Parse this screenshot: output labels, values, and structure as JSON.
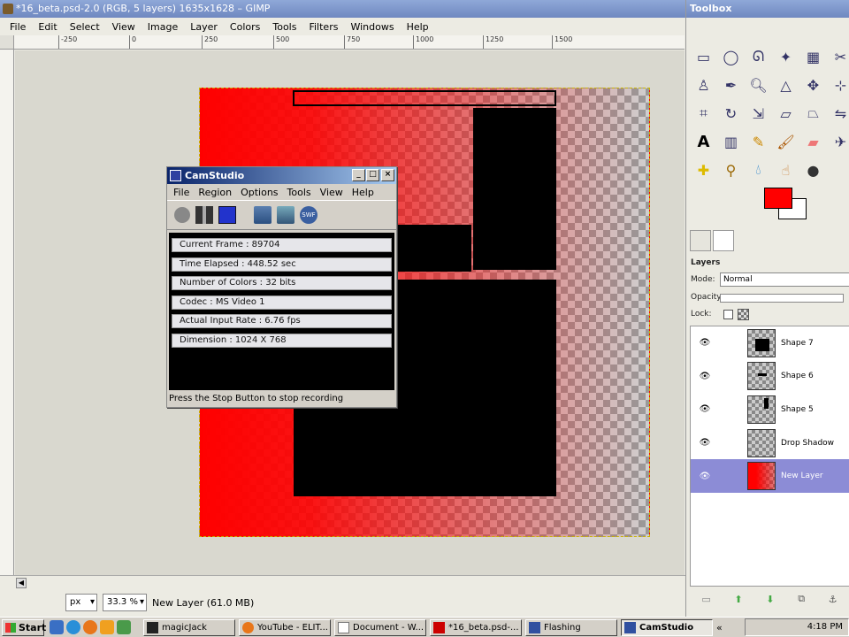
{
  "gimp": {
    "title": "*16_beta.psd-2.0 (RGB, 5 layers) 1635x1628 – GIMP",
    "menu": [
      "File",
      "Edit",
      "Select",
      "View",
      "Image",
      "Layer",
      "Colors",
      "Tools",
      "Filters",
      "Windows",
      "Help"
    ],
    "ruler_labels": [
      "-250",
      "0",
      "250",
      "500",
      "750",
      "1000",
      "1250",
      "1500"
    ],
    "status": {
      "unit": "px",
      "zoom": "33.3 %",
      "layer_info": "New Layer (61.0 MB)"
    }
  },
  "camstudio": {
    "title": "CamStudio",
    "menu": [
      "File",
      "Region",
      "Options",
      "Tools",
      "View",
      "Help"
    ],
    "info": [
      "Current Frame : 89704",
      "Time Elapsed : 448.52 sec",
      "Number of Colors : 32 bits",
      "Codec : MS Video 1",
      "Actual Input Rate : 6.76 fps",
      "Dimension : 1024 X 768"
    ],
    "status": "Press the Stop Button to stop recording"
  },
  "toolbox": {
    "title": "Toolbox",
    "fg_color": "#ff0000",
    "bg_color": "#ffffff",
    "layers_title": "Layers",
    "mode_label": "Mode:",
    "mode_value": "Normal",
    "opacity_label": "Opacity:",
    "lock_label": "Lock:",
    "layers": [
      {
        "name": "Shape 7",
        "visible": true,
        "selected": false
      },
      {
        "name": "Shape 6",
        "visible": true,
        "selected": false
      },
      {
        "name": "Shape 5",
        "visible": true,
        "selected": false
      },
      {
        "name": "Drop Shadow",
        "visible": true,
        "selected": false
      },
      {
        "name": "New Layer",
        "visible": true,
        "selected": true
      }
    ]
  },
  "taskbar": {
    "start": "Start",
    "tasks": [
      "magicJack",
      "YouTube - ELIT...",
      "Document - W...",
      "*16_beta.psd-...",
      "Flashing",
      "CamStudio"
    ],
    "active_task": "CamStudio",
    "clock": "4:18 PM"
  }
}
